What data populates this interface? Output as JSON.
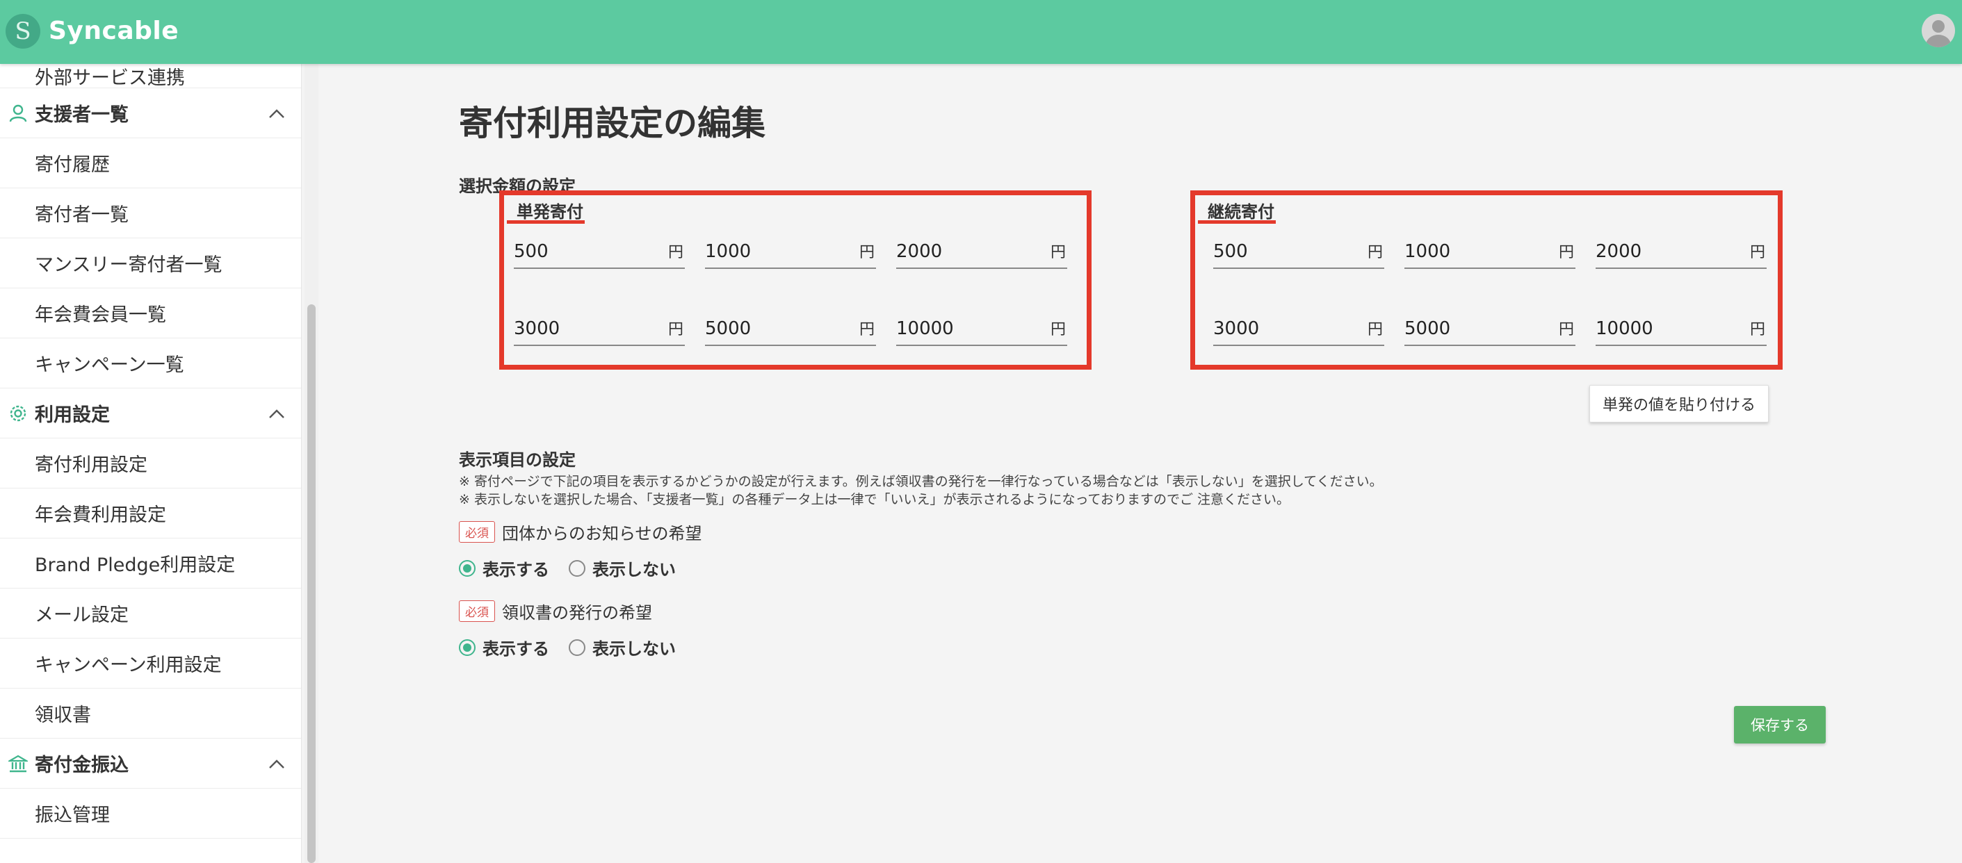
{
  "app": {
    "name": "Syncable",
    "logo_letter": "S"
  },
  "sidebar": {
    "top_item": "外部サービス連携",
    "sections": [
      {
        "label": "支援者一覧",
        "icon": "person-icon",
        "items": [
          "寄付履歴",
          "寄付者一覧",
          "マンスリー寄付者一覧",
          "年会費会員一覧",
          "キャンペーン一覧"
        ]
      },
      {
        "label": "利用設定",
        "icon": "gear-icon",
        "items": [
          "寄付利用設定",
          "年会費利用設定",
          "Brand Pledge利用設定",
          "メール設定",
          "キャンペーン利用設定",
          "領収書"
        ]
      },
      {
        "label": "寄付金振込",
        "icon": "bank-icon",
        "items": [
          "振込管理"
        ]
      }
    ]
  },
  "main": {
    "title": "寄付利用設定の編集",
    "amount_section_label": "選択金額の設定",
    "single": {
      "title": "単発寄付",
      "amounts": [
        "500",
        "1000",
        "2000",
        "3000",
        "5000",
        "10000"
      ],
      "unit": "円"
    },
    "monthly": {
      "title": "継続寄付",
      "amounts": [
        "500",
        "1000",
        "2000",
        "3000",
        "5000",
        "10000"
      ],
      "unit": "円"
    },
    "paste_button": "単発の値を貼り付ける",
    "display_section_label": "表示項目の設定",
    "note1": "※ 寄付ページで下記の項目を表示するかどうかの設定が行えます。例えば領収書の発行を一律行なっている場合などは「表示しない」を選択してください。",
    "note2": "※ 表示しないを選択した場合、「支援者一覧」の各種データ上は一律で「いいえ」が表示されるようになっておりますのでご 注意ください。",
    "required_badge": "必須",
    "fields": [
      {
        "label": "団体からのお知らせの希望",
        "show": "表示する",
        "hide": "表示しない"
      },
      {
        "label": "領収書の発行の希望",
        "show": "表示する",
        "hide": "表示しない"
      }
    ],
    "save_button": "保存する"
  },
  "colors": {
    "header": "#5ccaa0",
    "highlight": "#e4392b",
    "accent": "#3fb58d",
    "save": "#5bb26a"
  }
}
